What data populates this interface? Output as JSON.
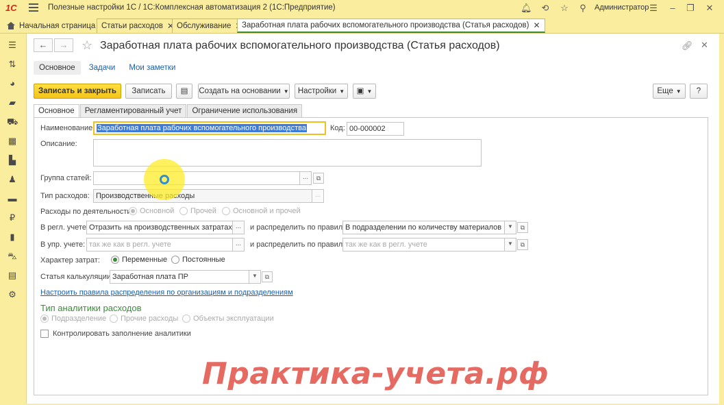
{
  "app": {
    "logo": "1С",
    "title": "Полезные настройки 1С / 1С:Комплексная автоматизация 2  (1С:Предприятие)",
    "user": "Администратор"
  },
  "tabs": [
    {
      "label": "Начальная страница"
    },
    {
      "label": "Статьи расходов"
    },
    {
      "label": "Обслуживание"
    },
    {
      "label": "Заработная плата рабочих вспомогательного производства (Статья расходов)"
    }
  ],
  "form": {
    "title": "Заработная плата рабочих вспомогательного производства (Статья расходов)",
    "subnav": [
      "Основное",
      "Задачи",
      "Мои заметки"
    ],
    "toolbar": {
      "save_close": "Записать и закрыть",
      "save": "Записать",
      "create_based": "Создать на основании",
      "settings": "Настройки",
      "more": "Еще",
      "help": "?"
    },
    "inner_tabs": [
      "Основное",
      "Регламентированный учет",
      "Ограничение использования"
    ],
    "fields": {
      "name_label": "Наименование:",
      "name_value": "Заработная плата рабочих вспомогательного производства",
      "code_label": "Код:",
      "code_value": "00-000002",
      "description_label": "Описание:",
      "group_label": "Группа статей:",
      "expense_type_label": "Тип расходов:",
      "expense_type_value": "Производственные расходы",
      "activity_label": "Расходы по деятельности:",
      "activity_options": [
        "Основной",
        "Прочей",
        "Основной и прочей"
      ],
      "reg_label": "В регл. учете:",
      "reg_value": "Отразить на производственных затратах",
      "distribute_label": "и распределить по правилу:",
      "reg_rule_value": "В подразделении по количеству материалов",
      "mgmt_label": "В упр. учете:",
      "mgmt_placeholder": "так же как в регл. учете",
      "mgmt_rule_placeholder": "так же как в регл. учете",
      "cost_nature_label": "Характер затрат:",
      "cost_nature_options": [
        "Переменные",
        "Постоянные"
      ],
      "calc_label": "Статья калькуляции:",
      "calc_value": "Заработная плата ПР",
      "rules_link": "Настроить правила распределения по организациям и подразделениям",
      "analytics_title": "Тип аналитики расходов",
      "analytics_options": [
        "Подразделение",
        "Прочие расходы",
        "Объекты эксплуатации"
      ],
      "control_label": "Контролировать заполнение аналитики"
    }
  },
  "watermark": "Практика-учета.рф"
}
